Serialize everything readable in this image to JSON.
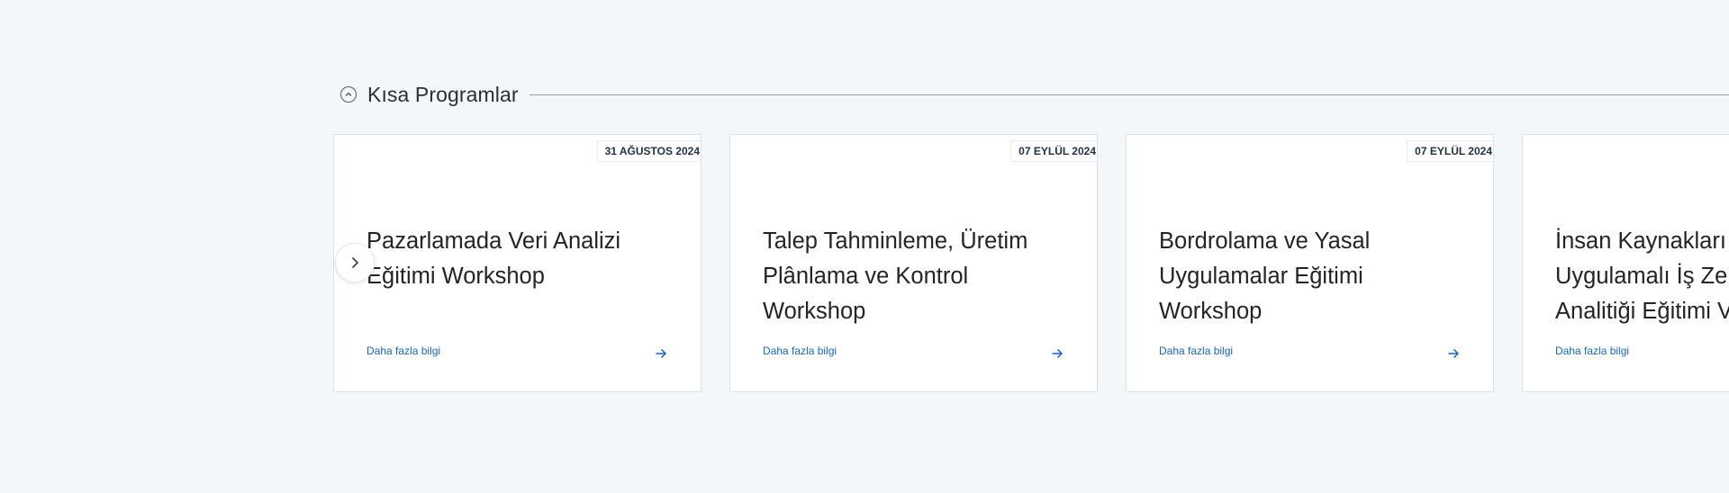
{
  "section": {
    "title": "Kısa Programlar",
    "collapse_icon": "chevron-up-circle-icon"
  },
  "carousel": {
    "nav_icon": "chevron-right-icon",
    "cards": [
      {
        "date": "31 AĞUSTOS 2024",
        "title_lines": [
          "Pazarlamada Veri Analizi",
          "Eğitimi Workshop"
        ],
        "link": "Daha fazla bilgi",
        "arrow_icon": "arrow-right-icon"
      },
      {
        "date": "07 EYLÜL 2024",
        "title_lines": [
          "Talep Tahminleme, Üretim",
          "Plânlama ve Kontrol",
          "Workshop"
        ],
        "link": "Daha fazla bilgi",
        "arrow_icon": "arrow-right-icon"
      },
      {
        "date": "07 EYLÜL 2024",
        "title_lines": [
          "Bordrolama ve Yasal",
          "Uygulamalar Eğitimi",
          "Workshop"
        ],
        "link": "Daha fazla bilgi",
        "arrow_icon": "arrow-right-icon"
      },
      {
        "date": "",
        "title_lines": [
          "İnsan Kaynakları",
          "Uygulamalı İş Ze",
          "Analitiği Eğitimi V"
        ],
        "link": "Daha fazla bilgi",
        "arrow_icon": "arrow-right-icon"
      }
    ]
  },
  "colors": {
    "background": "#f4f7fa",
    "link": "#1565c8",
    "date_text": "#253048"
  }
}
